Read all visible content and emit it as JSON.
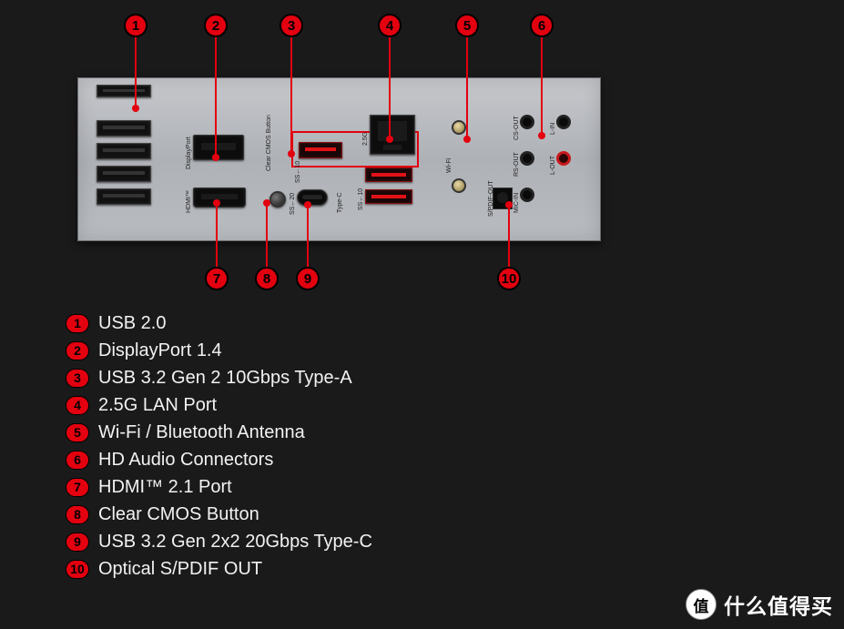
{
  "callouts": {
    "1": {
      "label": "1"
    },
    "2": {
      "label": "2"
    },
    "3": {
      "label": "3"
    },
    "4": {
      "label": "4"
    },
    "5": {
      "label": "5"
    },
    "6": {
      "label": "6"
    },
    "7": {
      "label": "7"
    },
    "8": {
      "label": "8"
    },
    "9": {
      "label": "9"
    },
    "10": {
      "label": "10"
    }
  },
  "legend": [
    {
      "num": "1",
      "text": "USB 2.0"
    },
    {
      "num": "2",
      "text": "DisplayPort 1.4"
    },
    {
      "num": "3",
      "text": "USB 3.2 Gen 2 10Gbps Type-A"
    },
    {
      "num": "4",
      "text": "2.5G LAN Port"
    },
    {
      "num": "5",
      "text": "Wi-Fi / Bluetooth Antenna"
    },
    {
      "num": "6",
      "text": "HD Audio Connectors"
    },
    {
      "num": "7",
      "text": "HDMI™ 2.1 Port"
    },
    {
      "num": "8",
      "text": "Clear CMOS Button"
    },
    {
      "num": "9",
      "text": "USB 3.2 Gen 2x2 20Gbps Type-C"
    },
    {
      "num": "10",
      "text": "Optical S/PDIF OUT"
    }
  ],
  "boardLabels": {
    "displayport": "DisplayPort",
    "hdmi": "HDMI™",
    "clearCmos": "Clear CMOS Button",
    "lan25g": "2.5G",
    "wifi": "Wi-Fi",
    "typec": "Type-C",
    "ss10_1": "SS←10",
    "ss10_2": "SS←10",
    "ss20": "SS←20",
    "spdif": "S/PDIF-OUT",
    "micin": "MIC-IN",
    "rsout": "RS-OUT",
    "lout": "L-OUT",
    "csout": "CS-OUT",
    "lin": "L-IN"
  },
  "watermark": {
    "badge": "值",
    "text": "什么值得买"
  }
}
